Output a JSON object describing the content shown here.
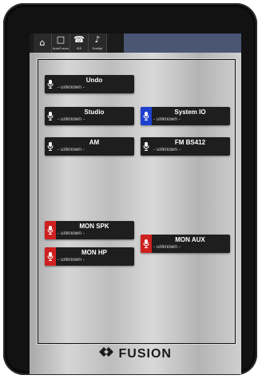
{
  "navbar": {
    "items": [
      {
        "label": "",
        "icon": "home-icon"
      },
      {
        "label": "AutoFusion",
        "icon": "square-icon"
      },
      {
        "label": "IDS",
        "icon": "phone-icon"
      },
      {
        "label": "Dreiltpf",
        "icon": "music-note-icon"
      }
    ],
    "accent_color": "#4a5674"
  },
  "channels": [
    {
      "name": "Undo",
      "status": "- unknown -",
      "mic_color": "neutral"
    },
    {
      "name": "Studio",
      "status": "- unknown -",
      "mic_color": "neutral"
    },
    {
      "name": "System IO",
      "status": "- unknown -",
      "mic_color": "blue"
    },
    {
      "name": "AM",
      "status": "- unknown -",
      "mic_color": "neutral"
    },
    {
      "name": "FM BS412",
      "status": "- unknown -",
      "mic_color": "neutral"
    },
    {
      "name": "MON SPK",
      "status": "- unknown -",
      "mic_color": "red"
    },
    {
      "name": "MON AUX",
      "status": "- unknown -",
      "mic_color": "red"
    },
    {
      "name": "MON HP",
      "status": "- unknown -",
      "mic_color": "red"
    }
  ],
  "logo": {
    "text": "FUSION"
  },
  "colors": {
    "red": "#cf2020",
    "blue": "#1f3fcf",
    "tile": "#1e1e1e"
  }
}
